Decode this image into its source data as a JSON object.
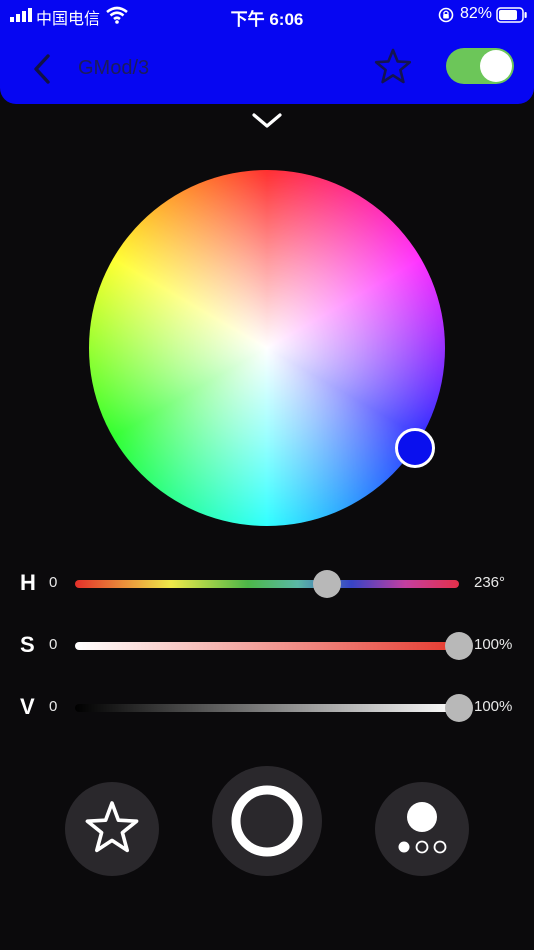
{
  "status_bar": {
    "carrier": "中国电信",
    "time": "下午 6:06",
    "battery": "82%",
    "battery_level": 0.82,
    "icons": [
      "signal-icon",
      "wifi-icon",
      "orientation-lock-icon",
      "battery-icon"
    ]
  },
  "header": {
    "title": "GMod/3",
    "power_on": true,
    "background_color": "#0606f2",
    "icons": [
      "back-chevron-icon",
      "favorite-star-icon"
    ]
  },
  "collapse_icon": "chevron-down-icon",
  "color_wheel": {
    "selected_color": "#0a10ee"
  },
  "sliders": {
    "h": {
      "letter": "H",
      "min": "0",
      "max": "236°",
      "value": 236,
      "range": 360
    },
    "s": {
      "letter": "S",
      "min": "0",
      "max": "100%",
      "value": 100,
      "range": 100
    },
    "v": {
      "letter": "V",
      "min": "0",
      "max": "100%",
      "value": 100,
      "range": 100
    }
  },
  "bottom_buttons": {
    "icons": [
      "star-outline-icon",
      "power-ring-icon",
      "scene-dots-icon"
    ]
  },
  "colors": {
    "toggle_on": "#6cc659",
    "background": "#0b0a0c",
    "thumb": "#b8b8b8"
  }
}
